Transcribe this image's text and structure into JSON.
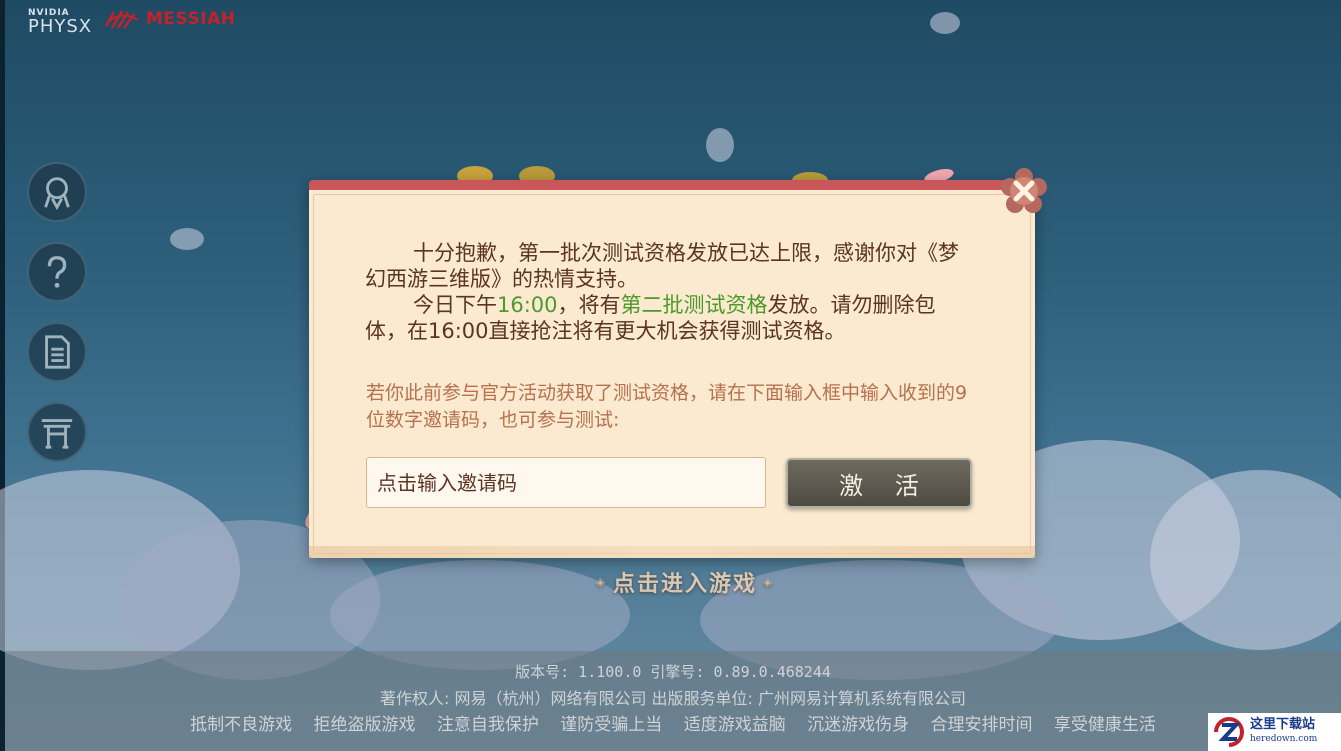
{
  "logos": {
    "physx_small": "NVIDIA",
    "physx_big": "PHYSX",
    "messiah": "MESSIAH"
  },
  "sidebar": {
    "items": [
      {
        "icon": "character-icon"
      },
      {
        "icon": "help-icon"
      },
      {
        "icon": "notice-icon"
      },
      {
        "icon": "gate-icon"
      }
    ]
  },
  "dialog": {
    "para1": "十分抱歉，第一批次测试资格发放已达上限，感谢你对《梦幻西游三维版》的热情支持。",
    "para2_a": "今日下午",
    "para2_time": "16:00",
    "para2_b": "，将有",
    "para2_highlight": "第二批测试资格",
    "para2_c": "发放。请勿删除包体，在16:00直接抢注将有更大机会获得测试资格。",
    "hint": "若你此前参与官方活动获取了测试资格，请在下面输入框中输入收到的9位数字邀请码，也可参与测试:",
    "input_placeholder": "点击输入邀请码",
    "activate_label": "激 活",
    "close_icon": "close-icon",
    "highlight_color": "#4b9a2a"
  },
  "enter_game": "点击进入游戏",
  "footer": {
    "version": "版本号: 1.100.0  引擎号: 0.89.0.468244",
    "copyright": "著作权人: 网易（杭州）网络有限公司  出版服务单位: 广州网易计算机系统有限公司",
    "notices": [
      "抵制不良游戏",
      "拒绝盗版游戏",
      "注意自我保护",
      "谨防受骗上当",
      "适度游戏益脑",
      "沉迷游戏伤身",
      "合理安排时间",
      "享受健康生活"
    ]
  },
  "watermark": {
    "title": "这里下载站",
    "sub": "heredown.com"
  }
}
